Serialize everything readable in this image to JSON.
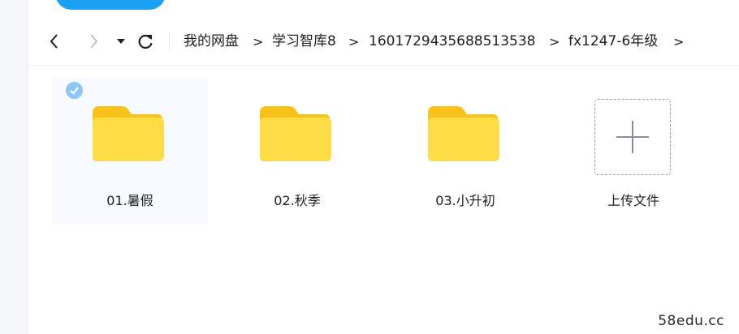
{
  "colors": {
    "accent": "#1aa0f5",
    "folder_front": "#ffdd47",
    "folder_back": "#f8c21a",
    "selected_check": "#8fc6f2"
  },
  "toolbar": {
    "back_icon": "chevron-left-icon",
    "forward_icon": "chevron-right-icon",
    "dropdown_icon": "caret-down-icon",
    "refresh_icon": "refresh-icon"
  },
  "breadcrumb": {
    "items": [
      {
        "label": "我的网盘"
      },
      {
        "label": "学习智库8"
      },
      {
        "label": "1601729435688513538"
      },
      {
        "label": "fx1247-6年级"
      }
    ],
    "separator": ">"
  },
  "files": [
    {
      "name": "01.暑假",
      "icon": "folder-icon",
      "selected": true
    },
    {
      "name": "02.秋季",
      "icon": "folder-icon",
      "selected": false
    },
    {
      "name": "03.小升初",
      "icon": "folder-icon",
      "selected": false
    }
  ],
  "upload": {
    "label": "上传文件",
    "icon": "plus-icon"
  },
  "watermark": "58edu.cc"
}
